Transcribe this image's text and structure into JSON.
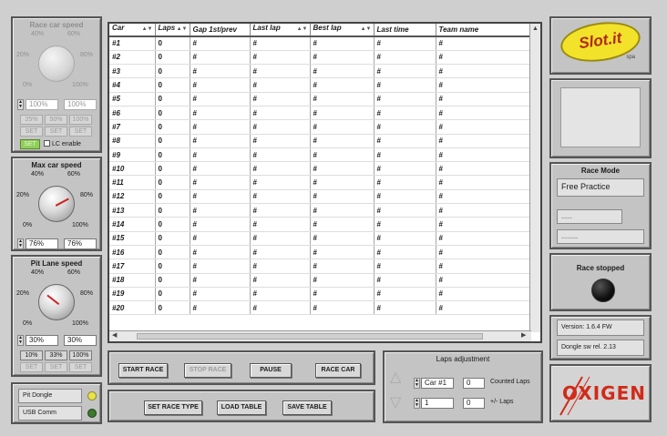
{
  "left": {
    "race_car_speed": {
      "title": "Race car speed",
      "ticks": {
        "t0": "0%",
        "t20": "20%",
        "t40": "40%",
        "t60": "60%",
        "t80": "80%",
        "t100": "100%"
      },
      "value": "100%",
      "value2": "100%",
      "buttons": [
        "25%",
        "50%",
        "100%",
        "SET",
        "SET",
        "SET"
      ],
      "set_label": "SET",
      "enable_label": "LC enable"
    },
    "max_car_speed": {
      "title": "Max car speed",
      "ticks": {
        "t0": "0%",
        "t20": "20%",
        "t40": "40%",
        "t60": "60%",
        "t80": "80%",
        "t100": "100%"
      },
      "value": "76%",
      "value2": "76%"
    },
    "pit_lane_speed": {
      "title": "Pit Lane speed",
      "ticks": {
        "t0": "0%",
        "t20": "20%",
        "t40": "40%",
        "t60": "60%",
        "t80": "80%",
        "t100": "100%"
      },
      "value": "30%",
      "value2": "30%",
      "buttons": [
        "10%",
        "33%",
        "100%",
        "SET",
        "SET",
        "SET"
      ]
    },
    "status": {
      "pit_dongle": "Pit Dongle",
      "usb_comm": "USB Comm"
    }
  },
  "table": {
    "headers": [
      "Car",
      "Laps",
      "Gap 1st/prev",
      "Last lap",
      "Best lap",
      "Last time",
      "Team name"
    ],
    "rows": [
      [
        "#1",
        "0",
        "#",
        "#",
        "#",
        "#",
        "#"
      ],
      [
        "#2",
        "0",
        "#",
        "#",
        "#",
        "#",
        "#"
      ],
      [
        "#3",
        "0",
        "#",
        "#",
        "#",
        "#",
        "#"
      ],
      [
        "#4",
        "0",
        "#",
        "#",
        "#",
        "#",
        "#"
      ],
      [
        "#5",
        "0",
        "#",
        "#",
        "#",
        "#",
        "#"
      ],
      [
        "#6",
        "0",
        "#",
        "#",
        "#",
        "#",
        "#"
      ],
      [
        "#7",
        "0",
        "#",
        "#",
        "#",
        "#",
        "#"
      ],
      [
        "#8",
        "0",
        "#",
        "#",
        "#",
        "#",
        "#"
      ],
      [
        "#9",
        "0",
        "#",
        "#",
        "#",
        "#",
        "#"
      ],
      [
        "#10",
        "0",
        "#",
        "#",
        "#",
        "#",
        "#"
      ],
      [
        "#11",
        "0",
        "#",
        "#",
        "#",
        "#",
        "#"
      ],
      [
        "#12",
        "0",
        "#",
        "#",
        "#",
        "#",
        "#"
      ],
      [
        "#13",
        "0",
        "#",
        "#",
        "#",
        "#",
        "#"
      ],
      [
        "#14",
        "0",
        "#",
        "#",
        "#",
        "#",
        "#"
      ],
      [
        "#15",
        "0",
        "#",
        "#",
        "#",
        "#",
        "#"
      ],
      [
        "#16",
        "0",
        "#",
        "#",
        "#",
        "#",
        "#"
      ],
      [
        "#17",
        "0",
        "#",
        "#",
        "#",
        "#",
        "#"
      ],
      [
        "#18",
        "0",
        "#",
        "#",
        "#",
        "#",
        "#"
      ],
      [
        "#19",
        "0",
        "#",
        "#",
        "#",
        "#",
        "#"
      ],
      [
        "#20",
        "0",
        "#",
        "#",
        "#",
        "#",
        "#"
      ]
    ]
  },
  "controls": {
    "start_race": "START RACE",
    "stop_race": "STOP RACE",
    "pause": "PAUSE",
    "race_car": "RACE CAR",
    "set_race_type": "SET RACE TYPE",
    "load_table": "LOAD TABLE",
    "save_table": "SAVE TABLE"
  },
  "laps_adjustment": {
    "title": "Laps adjustment",
    "car_value": "Car #1",
    "count1": "0",
    "counted_laps_label": "Counted Laps",
    "spin_value": "1",
    "count2": "0",
    "plus_minus_label": "+/- Laps"
  },
  "right": {
    "logo_text": "Slot.it",
    "logo_sub": "spa",
    "race_mode": {
      "title": "Race Mode",
      "mode": "Free Practice",
      "field1": "----",
      "field2": "------"
    },
    "race_status": "Race stopped",
    "info": {
      "version": "Version: 1.6.4 FW",
      "dongle": "Dongle sw rel. 2.13"
    },
    "brand_text": "OXIGEN"
  },
  "colors": {
    "led_yellow": "#e8e34a",
    "led_green": "#3d7a2d",
    "brand_red": "#d12a1a"
  }
}
